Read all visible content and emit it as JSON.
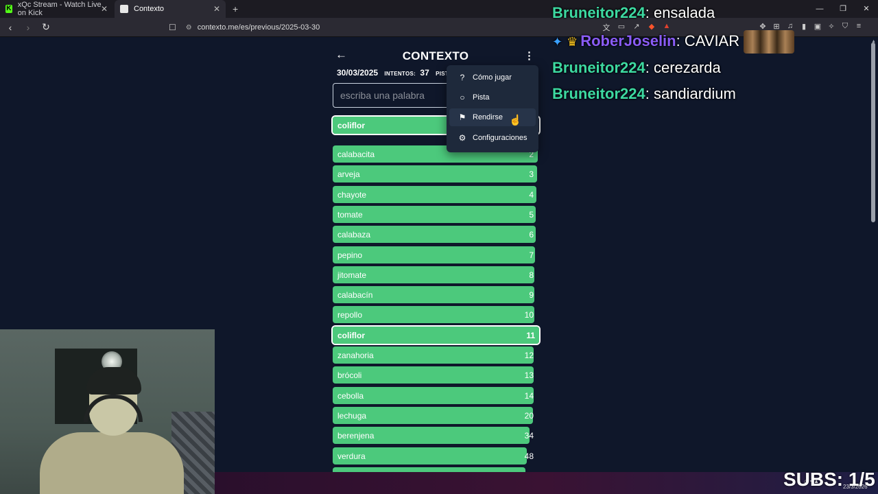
{
  "browser": {
    "tabs": [
      {
        "title": "xQc Stream - Watch Live on Kick",
        "icon": "kick-icon",
        "active": false
      },
      {
        "title": "Contexto",
        "icon": "contexto-icon",
        "active": true
      }
    ],
    "url": "contexto.me/es/previous/2025-03-30"
  },
  "game": {
    "title": "CONTEXTO",
    "date": "30/03/2025",
    "attempts_label": "INTENTOS:",
    "attempts": "37",
    "hints_label": "PISTA",
    "input_placeholder": "escriba una palabra",
    "current_guess": {
      "word": "coliflor",
      "rank": "11",
      "closeness": 0.965
    },
    "guesses": [
      {
        "word": "calabacita",
        "rank": "2",
        "closeness": 1.0
      },
      {
        "word": "arveja",
        "rank": "3",
        "closeness": 0.997
      },
      {
        "word": "chayote",
        "rank": "4",
        "closeness": 0.993
      },
      {
        "word": "tomate",
        "rank": "5",
        "closeness": 0.99
      },
      {
        "word": "calabaza",
        "rank": "6",
        "closeness": 0.99
      },
      {
        "word": "pepino",
        "rank": "7",
        "closeness": 0.987
      },
      {
        "word": "jitomate",
        "rank": "8",
        "closeness": 0.983
      },
      {
        "word": "calabacín",
        "rank": "9",
        "closeness": 0.983
      },
      {
        "word": "repollo",
        "rank": "10",
        "closeness": 0.983
      },
      {
        "word": "coliflor",
        "rank": "11",
        "closeness": 1.0,
        "current": true
      },
      {
        "word": "zanahoria",
        "rank": "12",
        "closeness": 0.98
      },
      {
        "word": "brócoli",
        "rank": "13",
        "closeness": 0.98
      },
      {
        "word": "cebolla",
        "rank": "14",
        "closeness": 0.98
      },
      {
        "word": "lechuga",
        "rank": "20",
        "closeness": 0.977
      },
      {
        "word": "berenjena",
        "rank": "34",
        "closeness": 0.96
      },
      {
        "word": "verdura",
        "rank": "48",
        "closeness": 0.947
      },
      {
        "word": "",
        "rank": "",
        "closeness": 0.94
      }
    ],
    "menu": [
      {
        "label": "Cómo jugar",
        "icon": "help-circle-icon"
      },
      {
        "label": "Pista",
        "icon": "lightbulb-icon"
      },
      {
        "label": "Rendirse",
        "icon": "flag-icon",
        "hovered": true
      },
      {
        "label": "Configuraciones",
        "icon": "gear-icon"
      }
    ]
  },
  "chat": [
    {
      "user": "Bruneitor224",
      "message": "ensalada"
    },
    {
      "user": "RoberJoselin",
      "message": "CAVIAR",
      "badges": [
        "sword-badge-icon",
        "crown-badge-icon"
      ],
      "emote": true
    },
    {
      "user": "Bruneitor224",
      "message": "cerezarda"
    },
    {
      "user": "Bruneitor224",
      "message": "sandiardium"
    }
  ],
  "overlay": {
    "subs": "SUBS: 1/5",
    "tray_date": "23/3/2026"
  },
  "colors": {
    "page_bg": "#0f172a",
    "bar_green": "#4cc97c",
    "chat_user": "#3dd9a1",
    "chat_user_alt": "#8a5cf6"
  }
}
